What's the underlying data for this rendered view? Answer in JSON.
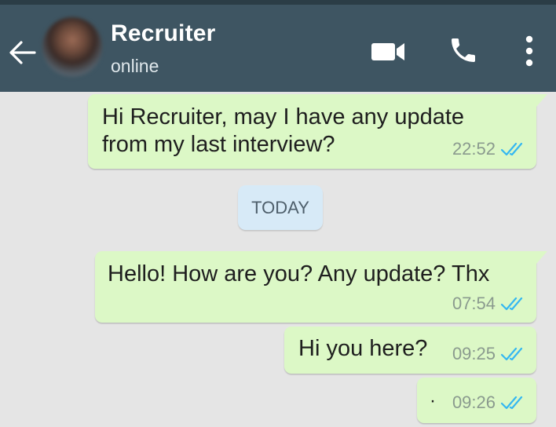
{
  "header": {
    "contact_name": "Recruiter",
    "status": "online",
    "background_color": "#3e5562",
    "icons": [
      "back-arrow-icon",
      "video-call-icon",
      "phone-icon",
      "more-options-icon"
    ]
  },
  "chat": {
    "background_color": "#e5e5e5",
    "outgoing_bubble_color": "#dcf8c6",
    "read_tick_color": "#34b7f1",
    "date_divider": "TODAY",
    "messages": [
      {
        "text": "Hi Recruiter, may I have any update from my last interview?",
        "time": "22:52",
        "direction": "outgoing",
        "status": "read"
      },
      {
        "text": "Hello! How are you? Any update? Thx",
        "time": "07:54",
        "direction": "outgoing",
        "status": "read"
      },
      {
        "text": "Hi you here?",
        "time": "09:25",
        "direction": "outgoing",
        "status": "read"
      },
      {
        "text": "·",
        "time": "09:26",
        "direction": "outgoing",
        "status": "read"
      }
    ]
  }
}
